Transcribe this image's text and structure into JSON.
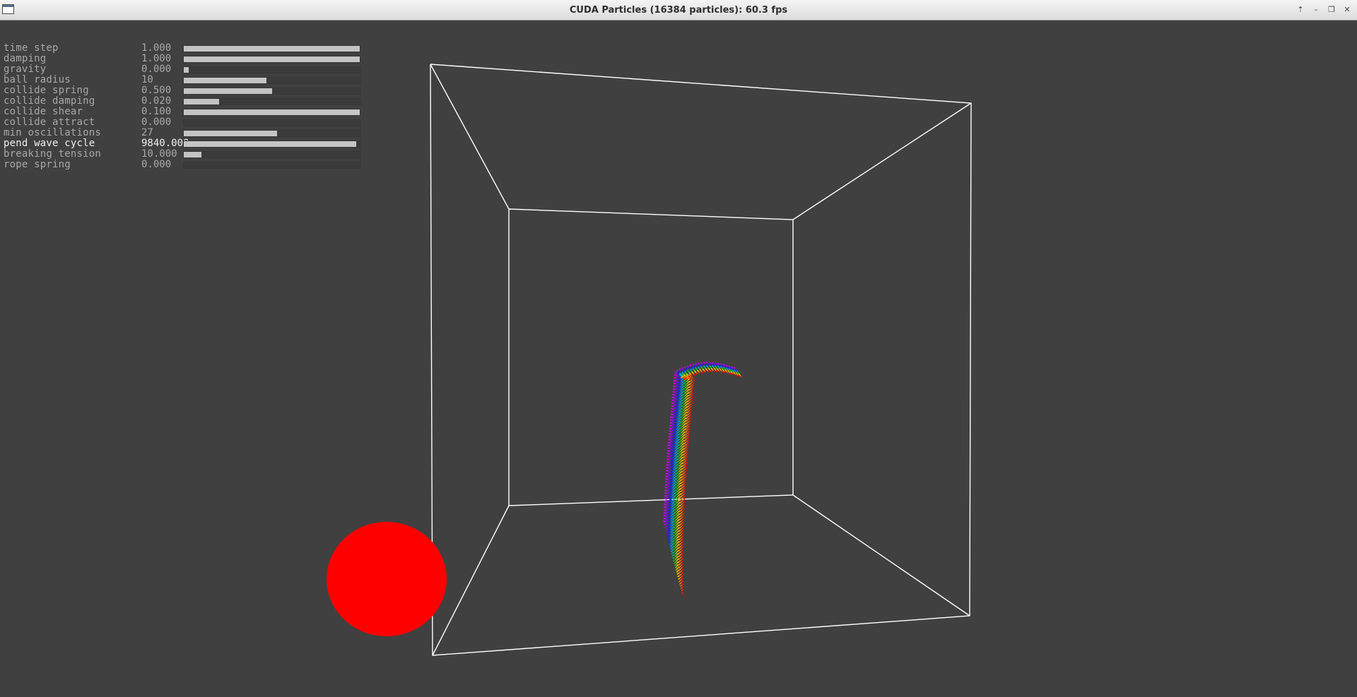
{
  "window": {
    "title": "CUDA Particles (16384 particles): 60.3 fps",
    "controls": [
      {
        "name": "keep-above-button",
        "glyph": "⇡"
      },
      {
        "name": "minimize-button",
        "glyph": "–"
      },
      {
        "name": "maximize-button",
        "glyph": "❐"
      },
      {
        "name": "close-button",
        "glyph": "✕"
      }
    ]
  },
  "params": [
    {
      "name": "time step",
      "value": "1.000",
      "fill": 1.0
    },
    {
      "name": "damping",
      "value": "1.000",
      "fill": 1.0
    },
    {
      "name": "gravity",
      "value": "0.000",
      "fill": 0.03
    },
    {
      "name": "ball radius",
      "value": "10",
      "fill": 0.47
    },
    {
      "name": "collide spring",
      "value": "0.500",
      "fill": 0.5
    },
    {
      "name": "collide damping",
      "value": "0.020",
      "fill": 0.2
    },
    {
      "name": "collide shear",
      "value": "0.100",
      "fill": 1.0
    },
    {
      "name": "collide attract",
      "value": "0.000",
      "fill": 0.0
    },
    {
      "name": "min oscillations",
      "value": "27",
      "fill": 0.53
    },
    {
      "name": "pend wave cycle",
      "value": "9840.000",
      "fill": 0.98,
      "active": true
    },
    {
      "name": "breaking tension",
      "value": "10.000",
      "fill": 0.1
    },
    {
      "name": "rope spring",
      "value": "0.000",
      "fill": 0.0
    }
  ],
  "scene": {
    "background": "#404040",
    "box_color": "#ffffff",
    "ball_color": "#ff0000",
    "particle_colors": [
      "#ff0000",
      "#ff7f00",
      "#ffd000",
      "#00c000",
      "#00b0ff",
      "#0020ff",
      "#8a00ff",
      "#ff00ff"
    ]
  }
}
